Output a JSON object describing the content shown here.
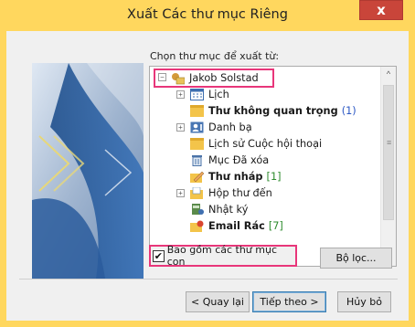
{
  "window": {
    "title": "Xuất Các thư mục Riêng",
    "close_label": "x"
  },
  "prompt": "Chọn thư mục để xuất từ:",
  "tree": {
    "root": {
      "label": "Jakob Solstad",
      "expander": "−"
    },
    "items": [
      {
        "label": "Lịch",
        "icon": "calendar-icon",
        "expander": "+",
        "bold": false,
        "count": ""
      },
      {
        "label": "Thư không quan trọng",
        "icon": "folder-icon",
        "expander": "",
        "bold": true,
        "count": "(1)"
      },
      {
        "label": "Danh bạ",
        "icon": "contacts-icon",
        "expander": "+",
        "bold": false,
        "count": ""
      },
      {
        "label": "Lịch sử Cuộc hội thoại",
        "icon": "folder-icon",
        "expander": "",
        "bold": false,
        "count": ""
      },
      {
        "label": "Mục Đã xóa",
        "icon": "trash-icon",
        "expander": "",
        "bold": false,
        "count": ""
      },
      {
        "label": "Thư nháp",
        "icon": "drafts-icon",
        "expander": "",
        "bold": true,
        "count": "[1]"
      },
      {
        "label": "Hộp thư đến",
        "icon": "inbox-icon",
        "expander": "+",
        "bold": false,
        "count": ""
      },
      {
        "label": "Nhật ký",
        "icon": "journal-icon",
        "expander": "",
        "bold": false,
        "count": ""
      },
      {
        "label": "Email Rác",
        "icon": "junk-mail-icon",
        "expander": "",
        "bold": true,
        "count": "[7]"
      }
    ]
  },
  "include_subfolders": {
    "label": "Bao gồm các thư mục con",
    "checked": true,
    "mark": "✔"
  },
  "filter_button": "Bộ lọc...",
  "buttons": {
    "back": "< Quay lại",
    "next": "Tiếp theo >",
    "cancel": "Hủy bỏ"
  },
  "colors": {
    "title_bar": "#ffd75e",
    "highlight": "#e8367a",
    "close": "#c9453a"
  }
}
